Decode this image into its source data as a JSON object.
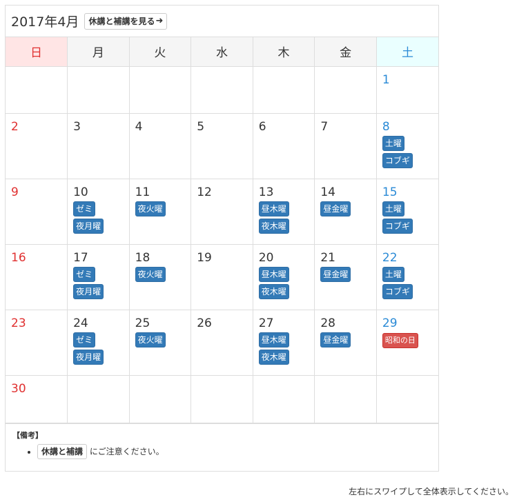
{
  "header": {
    "month_title": "2017年4月",
    "view_button_label": "休講と補講を見る",
    "view_button_icon": "arrow-right-icon"
  },
  "weekdays": [
    "日",
    "月",
    "火",
    "水",
    "木",
    "金",
    "土"
  ],
  "colors": {
    "sunday": "#e03030",
    "saturday": "#2a8ad6",
    "event": "#337ab7",
    "holiday": "#d9534f"
  },
  "weeks": [
    [
      {
        "day": ""
      },
      {
        "day": ""
      },
      {
        "day": ""
      },
      {
        "day": ""
      },
      {
        "day": ""
      },
      {
        "day": ""
      },
      {
        "day": "1"
      }
    ],
    [
      {
        "day": "2"
      },
      {
        "day": "3"
      },
      {
        "day": "4"
      },
      {
        "day": "5"
      },
      {
        "day": "6"
      },
      {
        "day": "7"
      },
      {
        "day": "8",
        "events": [
          "土曜",
          "コブギ"
        ]
      }
    ],
    [
      {
        "day": "9"
      },
      {
        "day": "10",
        "events": [
          "ゼミ",
          "夜月曜"
        ]
      },
      {
        "day": "11",
        "events": [
          "夜火曜"
        ]
      },
      {
        "day": "12"
      },
      {
        "day": "13",
        "events": [
          "昼木曜",
          "夜木曜"
        ]
      },
      {
        "day": "14",
        "events": [
          "昼金曜"
        ]
      },
      {
        "day": "15",
        "events": [
          "土曜",
          "コブギ"
        ]
      }
    ],
    [
      {
        "day": "16"
      },
      {
        "day": "17",
        "events": [
          "ゼミ",
          "夜月曜"
        ]
      },
      {
        "day": "18",
        "events": [
          "夜火曜"
        ]
      },
      {
        "day": "19"
      },
      {
        "day": "20",
        "events": [
          "昼木曜",
          "夜木曜"
        ]
      },
      {
        "day": "21",
        "events": [
          "昼金曜"
        ]
      },
      {
        "day": "22",
        "events": [
          "土曜",
          "コブギ"
        ]
      }
    ],
    [
      {
        "day": "23"
      },
      {
        "day": "24",
        "events": [
          "ゼミ",
          "夜月曜"
        ]
      },
      {
        "day": "25",
        "events": [
          "夜火曜"
        ]
      },
      {
        "day": "26"
      },
      {
        "day": "27",
        "events": [
          "昼木曜",
          "夜木曜"
        ]
      },
      {
        "day": "28",
        "events": [
          "昼金曜"
        ]
      },
      {
        "day": "29",
        "holiday": "昭和の日"
      }
    ],
    [
      {
        "day": "30"
      },
      {
        "day": ""
      },
      {
        "day": ""
      },
      {
        "day": ""
      },
      {
        "day": ""
      },
      {
        "day": ""
      },
      {
        "day": ""
      }
    ]
  ],
  "notes": {
    "title": "【備考】",
    "button_label": "休講と補講",
    "text": "にご注意ください。"
  },
  "footer_hint": "左右にスワイプして全体表示してください。"
}
